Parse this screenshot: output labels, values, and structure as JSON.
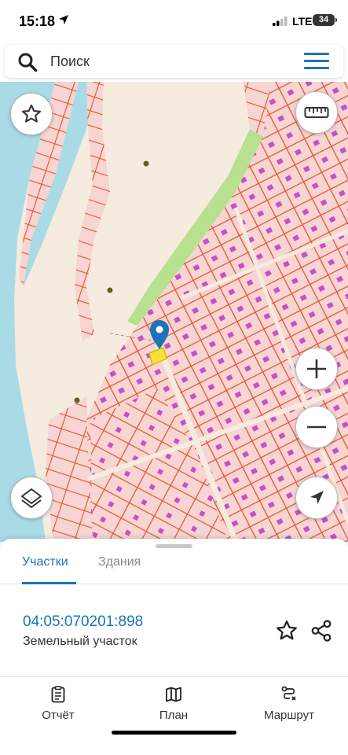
{
  "status": {
    "time": "15:18",
    "network": "LTE",
    "battery": "34"
  },
  "search": {
    "placeholder": "Поиск"
  },
  "sheet": {
    "tabs": [
      {
        "label": "Участки",
        "active": true
      },
      {
        "label": "Здания",
        "active": false
      }
    ],
    "parcel": {
      "number": "04:05:070201:898",
      "type": "Земельный участок"
    }
  },
  "nav": [
    {
      "label": "Отчёт",
      "icon": "report-icon"
    },
    {
      "label": "План",
      "icon": "map-icon"
    },
    {
      "label": "Маршрут",
      "icon": "route-icon"
    }
  ],
  "colors": {
    "accent": "#1a74b8",
    "water": "#a8dbe6",
    "land": "#f5ecdf",
    "parcel_fill": "#f6d5d2",
    "parcel_border": "#e8532f",
    "forest": "#b7e08f",
    "building": "#c94ec8",
    "selected": "#f7e23a"
  }
}
